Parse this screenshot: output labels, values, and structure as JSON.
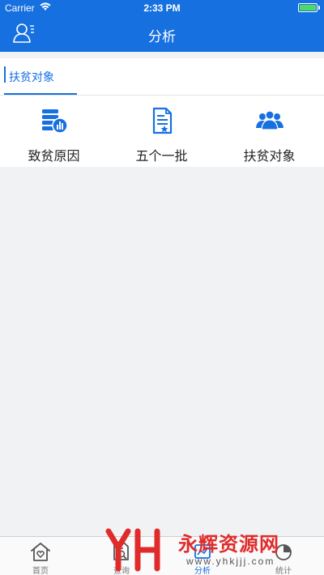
{
  "status_bar": {
    "carrier": "Carrier",
    "time": "2:33 PM",
    "battery_color": "#4cd964"
  },
  "nav": {
    "title": "分析",
    "left_icon": "user-profile-icon"
  },
  "tabs": [
    {
      "label": "扶贫对象",
      "selected": true
    }
  ],
  "grid": [
    {
      "label": "致贫原因",
      "icon": "poverty-cause-chart-icon"
    },
    {
      "label": "五个一批",
      "icon": "document-star-icon"
    },
    {
      "label": "扶贫对象",
      "icon": "people-group-icon"
    }
  ],
  "tab_bar": [
    {
      "label": "首页",
      "icon": "home-heart-icon",
      "active": false
    },
    {
      "label": "查询",
      "icon": "search-document-icon",
      "active": false
    },
    {
      "label": "分析",
      "icon": "analysis-icon",
      "active": true
    },
    {
      "label": "统计",
      "icon": "statistics-icon",
      "active": false
    }
  ],
  "watermark": {
    "text": "永辉资源网",
    "url": "www.yhkjjj.com"
  },
  "colors": {
    "primary": "#1670e0",
    "background": "#f1f2f4",
    "watermark": "#e02b2b"
  }
}
